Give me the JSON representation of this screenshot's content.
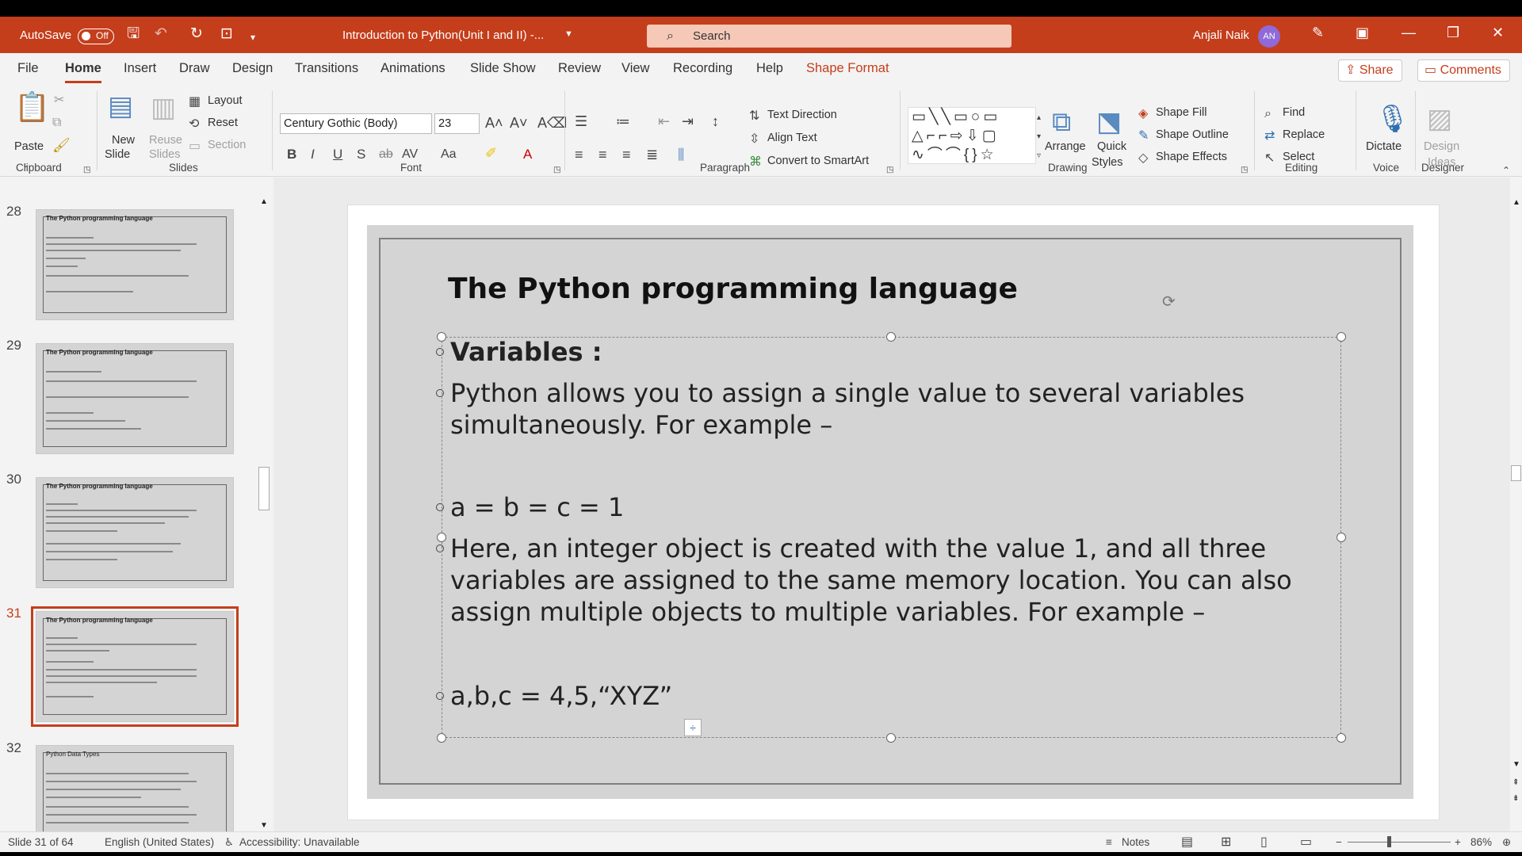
{
  "titlebar": {
    "autosave_label": "AutoSave",
    "autosave_state": "Off",
    "doc_title": "Introduction to Python(Unit I and II)  -...",
    "search_placeholder": "Search",
    "user_name": "Anjali Naik",
    "user_initials": "AN"
  },
  "menu": [
    "File",
    "Home",
    "Insert",
    "Draw",
    "Design",
    "Transitions",
    "Animations",
    "Slide Show",
    "Review",
    "View",
    "Recording",
    "Help",
    "Shape Format"
  ],
  "share_label": "Share",
  "comments_label": "Comments",
  "ribbon": {
    "clipboard": {
      "paste": "Paste",
      "group": "Clipboard"
    },
    "slides": {
      "new_slide": "New",
      "new_slide2": "Slide",
      "reuse": "Reuse",
      "reuse2": "Slides",
      "layout": "Layout",
      "reset": "Reset",
      "section": "Section",
      "group": "Slides"
    },
    "font": {
      "name": "Century Gothic (Body)",
      "size": "23",
      "group": "Font"
    },
    "paragraph": {
      "text_direction": "Text Direction",
      "align_text": "Align Text",
      "smartart": "Convert to SmartArt",
      "group": "Paragraph"
    },
    "drawing": {
      "arrange": "Arrange",
      "quick": "Quick",
      "styles": "Styles",
      "shape_fill": "Shape Fill",
      "shape_outline": "Shape Outline",
      "shape_effects": "Shape Effects",
      "group": "Drawing"
    },
    "editing": {
      "find": "Find",
      "replace": "Replace",
      "select": "Select",
      "group": "Editing"
    },
    "voice": {
      "dictate": "Dictate",
      "group": "Voice"
    },
    "designer": {
      "ideas1": "Design",
      "ideas2": "Ideas",
      "group": "Designer"
    }
  },
  "thumbnails": [
    {
      "num": "28",
      "title": "The Python programming language"
    },
    {
      "num": "29",
      "title": "The Python programming language"
    },
    {
      "num": "30",
      "title": "The Python programming language"
    },
    {
      "num": "31",
      "title": "The Python programming language"
    },
    {
      "num": "32",
      "title": "Python Data Types"
    }
  ],
  "slide": {
    "title": "The Python programming language",
    "bullets": [
      "Variables :",
      "Python allows you to assign a single value to several variables simultaneously. For example –",
      "a = b = c = 1",
      "Here, an integer object is created with the value 1, and all three variables are assigned to the same memory location. You can also assign multiple objects to multiple variables. For example –",
      "a,b,c = 4,5,“XYZ”"
    ]
  },
  "status": {
    "slide_info": "Slide 31 of 64",
    "language": "English (United States)",
    "accessibility": "Accessibility: Unavailable",
    "notes": "Notes",
    "zoom": "86%"
  }
}
